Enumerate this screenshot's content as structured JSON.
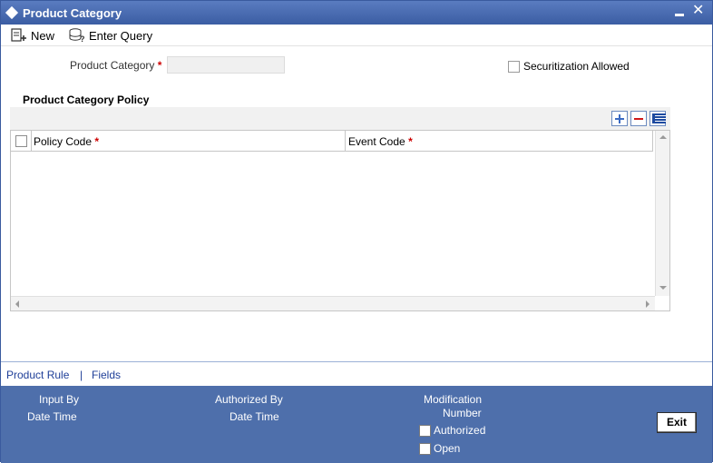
{
  "window": {
    "title": "Product Category"
  },
  "toolbar": {
    "new_label": "New",
    "enter_query_label": "Enter Query"
  },
  "form": {
    "product_category_label": "Product Category",
    "required_mark": "*",
    "product_category_value": "",
    "securitization_label": "Securitization Allowed",
    "securitization_checked": false
  },
  "policy_section": {
    "title": "Product Category Policy",
    "columns": [
      {
        "label": "Policy Code",
        "required": "*"
      },
      {
        "label": "Event Code",
        "required": "*"
      }
    ],
    "rows": []
  },
  "links": {
    "product_rule": "Product Rule",
    "separator": "|",
    "fields": "Fields"
  },
  "footer": {
    "input_by": "Input By",
    "date_time_1": "Date Time",
    "authorized_by": "Authorized By",
    "date_time_2": "Date Time",
    "modification": "Modification",
    "number": "Number",
    "authorized": "Authorized",
    "open": "Open",
    "exit": "Exit"
  },
  "colors": {
    "title_bar": "#3b5da3",
    "footer": "#4e6fab",
    "link": "#1f3f98",
    "required": "#cc0000"
  },
  "icons": [
    "diamond-icon",
    "minimize-icon",
    "close-icon",
    "new-doc-icon",
    "enter-query-icon",
    "add-row-icon",
    "delete-row-icon",
    "single-record-view-icon"
  ]
}
